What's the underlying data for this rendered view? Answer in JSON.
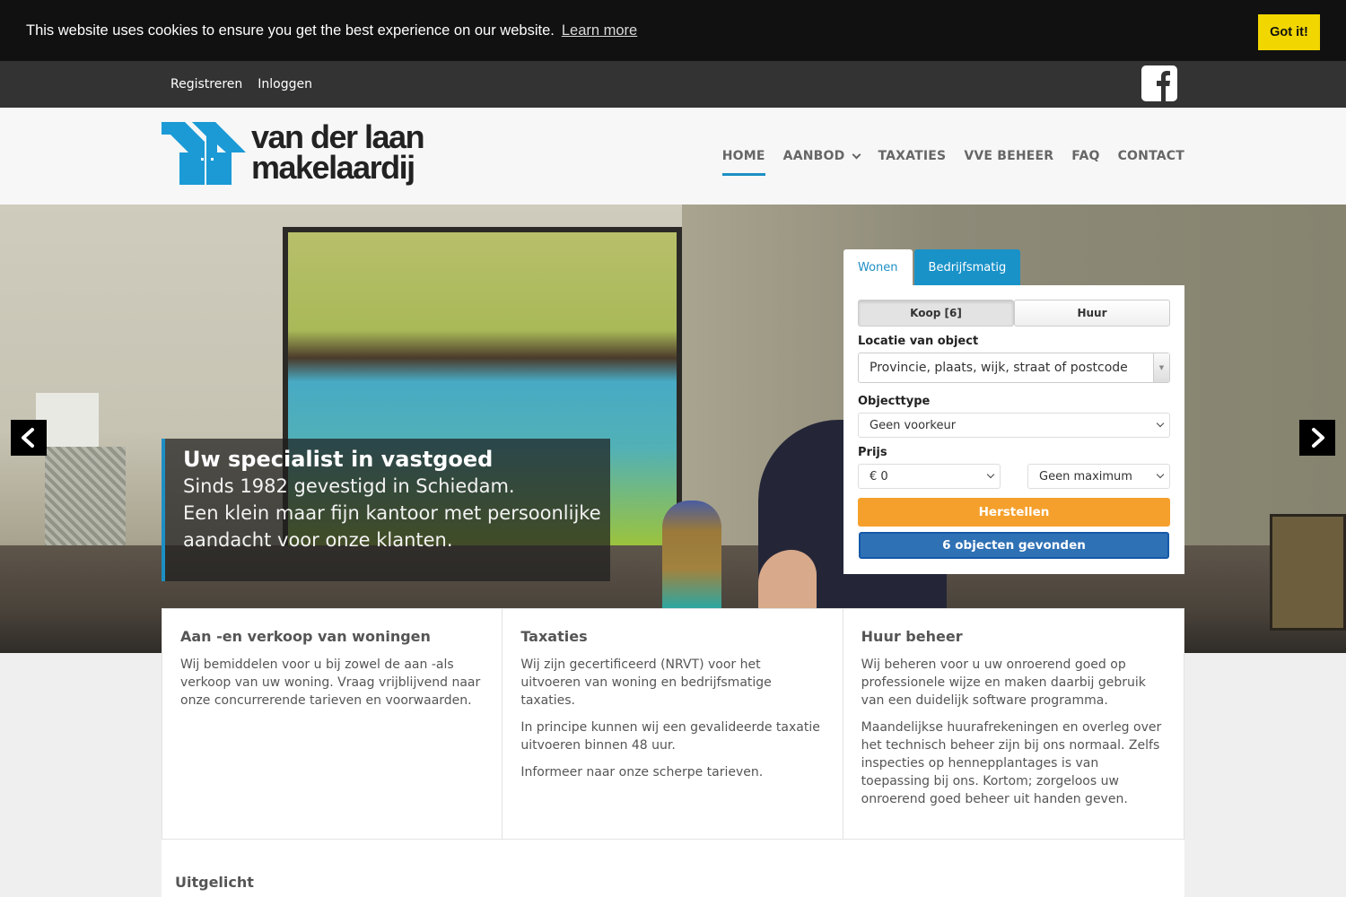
{
  "cookie": {
    "message": "This website uses cookies to ensure you get the best experience on our website.",
    "learn_more": "Learn more",
    "accept": "Got it!"
  },
  "topbar": {
    "links": [
      "Registreren",
      "Inloggen"
    ],
    "social_icon": "facebook-icon"
  },
  "brand": {
    "line1": "van der laan",
    "line2": "makelaardij",
    "color": "#1b9ad6"
  },
  "nav": {
    "items": [
      {
        "label": "HOME",
        "active": true
      },
      {
        "label": "AANBOD",
        "has_dropdown": true
      },
      {
        "label": "TAXATIES"
      },
      {
        "label": "VVE BEHEER"
      },
      {
        "label": "FAQ"
      },
      {
        "label": "CONTACT"
      }
    ],
    "accent": "#1d8fc4"
  },
  "hero": {
    "prev_icon": "chevron-left-icon",
    "next_icon": "chevron-right-icon",
    "caption": {
      "title": "Uw specialist in vastgoed",
      "line1": "Sinds 1982 gevestigd in Schiedam.",
      "line2": "Een klein maar fijn kantoor met persoonlijke aandacht voor onze klanten."
    }
  },
  "search": {
    "tabs": [
      "Wonen",
      "Bedrijfsmatig"
    ],
    "toggle": [
      "Koop [6]",
      "Huur"
    ],
    "location_label": "Locatie van object",
    "location_placeholder": "Provincie, plaats, wijk, straat of postcode",
    "objecttype_label": "Objecttype",
    "objecttype_value": "Geen voorkeur",
    "price_label": "Prijs",
    "price_min": "€ 0",
    "price_max": "Geen maximum",
    "reset_label": "Herstellen",
    "results_label": "6 objecten gevonden",
    "reset_color": "#f5a02c",
    "results_color": "#2f71b5"
  },
  "features": [
    {
      "title": "Aan -en verkoop van woningen",
      "paragraphs": [
        "Wij bemiddelen voor u bij zowel de aan -als verkoop van uw woning. Vraag vrijblijvend naar onze concurrerende tarieven en voorwaarden."
      ]
    },
    {
      "title": "Taxaties",
      "paragraphs": [
        "Wij zijn gecertificeerd (NRVT) voor het uitvoeren van woning en bedrijfsmatige taxaties.",
        "In principe kunnen wij een gevalideerde taxatie uitvoeren binnen 48 uur.",
        "Informeer naar onze scherpe tarieven."
      ]
    },
    {
      "title": "Huur beheer",
      "paragraphs": [
        "Wij beheren voor u uw onroerend goed op professionele wijze en maken daarbij gebruik van een duidelijk software programma.",
        "Maandelijkse huurafrekeningen en overleg over het technisch beheer zijn bij ons normaal. Zelfs inspecties op hennepplantages is van toepassing bij ons. Kortom; zorgeloos uw onroerend goed beheer uit handen geven."
      ]
    }
  ],
  "featured": {
    "title": "Uitgelicht"
  }
}
